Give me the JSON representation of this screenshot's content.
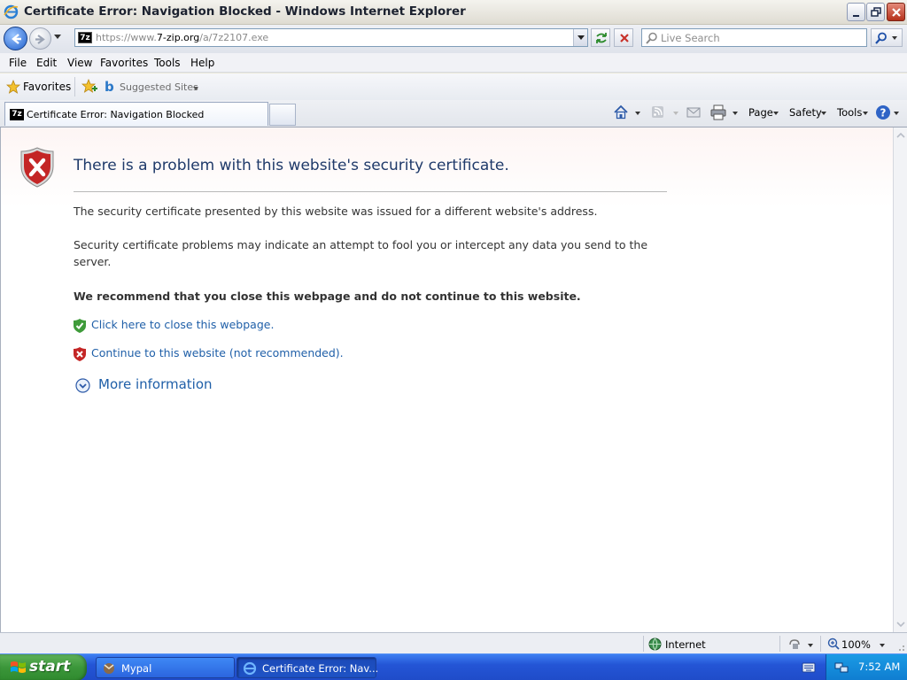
{
  "window": {
    "title": "Certificate Error: Navigation Blocked - Windows Internet Explorer"
  },
  "address_bar": {
    "url_prefix": "https://www.",
    "url_domain": "7-zip.org",
    "url_suffix": "/a/7z2107.exe",
    "favicon_text": "7z"
  },
  "search": {
    "placeholder": "Live Search"
  },
  "menu": {
    "items": [
      "File",
      "Edit",
      "View",
      "Favorites",
      "Tools",
      "Help"
    ]
  },
  "favorites_bar": {
    "favorites_label": "Favorites",
    "suggested_sites": "Suggested Sites"
  },
  "tab": {
    "label": "Certificate Error: Navigation Blocked"
  },
  "command_bar": {
    "page": "Page",
    "safety": "Safety",
    "tools": "Tools"
  },
  "content": {
    "heading": "There is a problem with this website's security certificate.",
    "para1": "The security certificate presented by this website was issued for a different website's address.",
    "para2": "Security certificate problems may indicate an attempt to fool you or intercept any data you send to the server.",
    "recommend": "We recommend that you close this webpage and do not continue to this website.",
    "close_link": "Click here to close this webpage.",
    "continue_link": "Continue to this website (not recommended).",
    "more_info": "More information"
  },
  "status_bar": {
    "zone": "Internet",
    "zoom": "100%"
  },
  "taskbar": {
    "start_label": "start",
    "tasks": [
      "Mypal",
      "Certificate Error: Nav..."
    ],
    "clock": "7:52 AM"
  },
  "colors": {
    "link": "#1f5fa8",
    "heading": "#1f3a6a",
    "taskbar": "#2455d6",
    "start_green": "#3b963a"
  }
}
